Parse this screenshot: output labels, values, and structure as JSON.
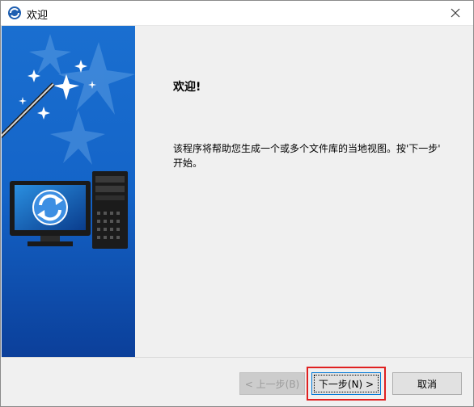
{
  "window": {
    "title": "欢迎"
  },
  "content": {
    "heading": "欢迎!",
    "body_line1": "该程序将帮助您生成一个或多个文件库的当地视图。按'下一步'",
    "body_line2": "开始。"
  },
  "buttons": {
    "back_label": "< 上一步(B)",
    "next_label": "下一步(N) >",
    "cancel_label": "取消"
  },
  "colors": {
    "banner_top": "#0d5fc4",
    "banner_bottom": "#0b3f9a",
    "accent": "#0078d7",
    "highlight": "#e02020"
  }
}
